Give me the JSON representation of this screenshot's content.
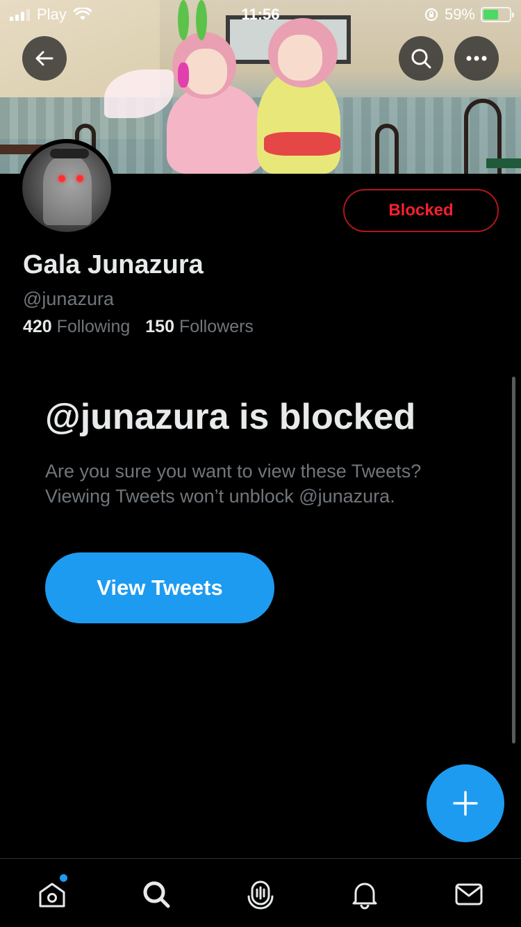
{
  "status_bar": {
    "carrier": "Play",
    "time": "11:56",
    "battery_percent": "59%",
    "battery_level": 0.59,
    "icons": [
      "signal-icon",
      "wifi-icon",
      "orientation-lock-icon",
      "battery-charging-icon"
    ]
  },
  "header": {
    "back_icon": "arrow-left-icon",
    "search_icon": "search-icon",
    "more_icon": "more-horizontal-icon"
  },
  "profile": {
    "name": "Gala Junazura",
    "handle": "@junazura",
    "following_count": "420",
    "following_label": "Following",
    "followers_count": "150",
    "followers_label": "Followers",
    "blocked_button_label": "Blocked"
  },
  "blocked_notice": {
    "title": "@junazura is blocked",
    "description": "Are you sure you want to view these Tweets? Viewing Tweets won’t unblock @junazura.",
    "view_button_label": "View Tweets"
  },
  "fab": {
    "icon": "plus-icon"
  },
  "tab_bar": {
    "tabs": [
      {
        "name": "home",
        "icon": "home-icon",
        "has_notification_dot": true
      },
      {
        "name": "search",
        "icon": "search-icon",
        "active": true
      },
      {
        "name": "spaces",
        "icon": "spaces-icon"
      },
      {
        "name": "notifications",
        "icon": "bell-icon"
      },
      {
        "name": "messages",
        "icon": "mail-icon"
      }
    ]
  },
  "colors": {
    "accent": "#1d9bf0",
    "blocked_red": "#f4212e",
    "background": "#000000",
    "secondary_text": "#71767b"
  }
}
